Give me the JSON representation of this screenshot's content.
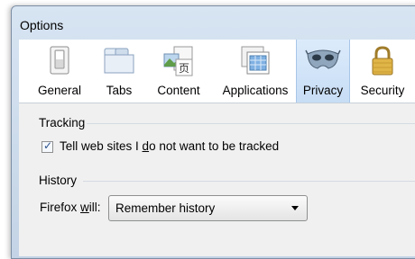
{
  "window": {
    "title": "Options"
  },
  "toolbar": {
    "items": [
      {
        "label": "General",
        "icon": "switch-icon"
      },
      {
        "label": "Tabs",
        "icon": "tabs-icon"
      },
      {
        "label": "Content",
        "icon": "content-icon"
      },
      {
        "label": "Applications",
        "icon": "applications-icon"
      },
      {
        "label": "Privacy",
        "icon": "privacy-mask-icon",
        "selected": true
      },
      {
        "label": "Security",
        "icon": "padlock-icon"
      }
    ]
  },
  "tracking": {
    "title": "Tracking",
    "checkbox_checked": true,
    "checkbox_label_pre": "Tell web sites I ",
    "checkbox_label_u": "d",
    "checkbox_label_post": "o not want to be tracked"
  },
  "history": {
    "title": "History",
    "label_pre": "Firefox ",
    "label_u": "w",
    "label_post": "ill:",
    "select_value": "Remember history"
  },
  "colors": {
    "selected_tab_bg": "#c7ddf5",
    "dialog_bg": "#f0f0f0"
  }
}
